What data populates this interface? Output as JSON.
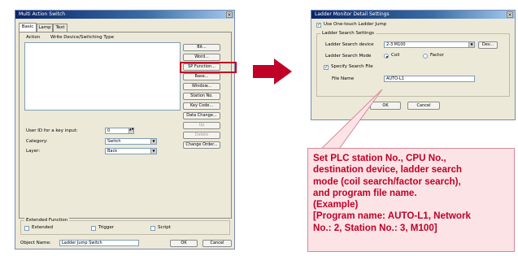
{
  "left_dialog": {
    "title": "Multi Action Switch",
    "close": "×",
    "tabs": [
      "Basic",
      "Lamp",
      "Text"
    ],
    "list_headers": {
      "action": "Action",
      "device": "Write Device/Switching Type"
    },
    "buttons": [
      "Bit...",
      "Word...",
      "SP Function...",
      "Base...",
      "Window...",
      "Station No.",
      "Key Code...",
      "Data Change...",
      "Up",
      "Delete",
      "Change Order..."
    ],
    "user_id_label": "User ID for a key input:",
    "user_id_value": "0",
    "category_label": "Category:",
    "category_value": "Switch",
    "layer_label": "Layer:",
    "layer_value": "Back",
    "extended_function": {
      "title": "Extended Function",
      "extended": "Extended",
      "trigger": "Trigger",
      "script": "Script"
    },
    "object_name_label": "Object Name:",
    "object_name_value": "Ladder Jump Switch",
    "ok": "OK",
    "cancel": "Cancel"
  },
  "right_dialog": {
    "title": "Ladder Monitor Detail Settings",
    "close": "×",
    "use_onetouch": "Use One-touch Ladder Jump",
    "ladder_search_group": "Ladder Search Settings",
    "ladder_search_device_label": "Ladder Search device",
    "ladder_search_device_value": "2-3 M100",
    "dev_button": "Dev...",
    "ladder_search_mode_label": "Ladder Search Mode",
    "mode_coil": "Coil",
    "mode_factor": "Factor",
    "specify_file": "Specify Search File",
    "file_name_label": "File Name",
    "file_name_value": "AUTO-L1",
    "ok": "OK",
    "cancel": "Cancel"
  },
  "callout_lines": [
    "Set PLC station No., CPU No.,",
    "destination device, ladder search",
    "mode (coil search/factor search),",
    "and program file name.",
    "(Example)",
    "[Program name: AUTO-L1, Network",
    "No.: 2, Station No.: 3, M100]"
  ],
  "colors": {
    "accent_red": "#c00026",
    "callout_bg": "#fbe3e6",
    "dialog_bg": "#ece9d8",
    "title_blue": "#0a246a"
  },
  "icons": {
    "arrow": "right-arrow-icon",
    "close": "close-icon",
    "dropdown": "chevron-down-icon"
  }
}
